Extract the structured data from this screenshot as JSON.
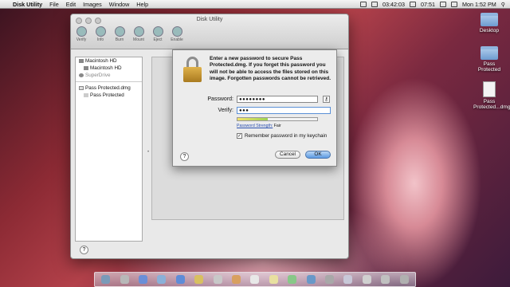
{
  "menubar": {
    "app_name": "Disk Utility",
    "items": [
      "File",
      "Edit",
      "Images",
      "Window",
      "Help"
    ],
    "clock1": "03:42:03",
    "clock2": "07:51",
    "datetime": "Mon 1:52 PM"
  },
  "desktop": {
    "icons": [
      {
        "label": "Desktop",
        "icon": "folder-icon"
      },
      {
        "label": "Pass Protected",
        "icon": "folder-icon"
      },
      {
        "label": "Pass Protected...dmg",
        "icon": "dmg-file-icon"
      }
    ]
  },
  "window": {
    "title": "Disk Utility",
    "toolbar": [
      "Verify",
      "Info",
      "Burn",
      "Mount",
      "Eject",
      "Enable"
    ],
    "sidebar": {
      "items": [
        {
          "label": "Macintosh HD",
          "level": 0
        },
        {
          "label": "Macintosh HD",
          "level": 1
        },
        {
          "label": "SuperDrive",
          "level": 0
        }
      ],
      "images": [
        {
          "label": "Pass Protected.dmg",
          "level": 0
        },
        {
          "label": "Pass Protected",
          "level": 1
        }
      ]
    },
    "help_label": "?"
  },
  "dialog": {
    "message": "Enter a new password to secure Pass Protected.dmg.  If you forget this password you will not be able to access the files stored on this image. Forgotten passwords cannot be retrieved.",
    "password_label": "Password:",
    "password_value": "●●●●●●●●",
    "verify_label": "Verify:",
    "verify_value": "●●●",
    "strength_label": "Password Strength:",
    "strength_value": "Fair",
    "strength_level": 0.38,
    "remember_label": "Remember password in my keychain",
    "remember_checked": true,
    "cancel_label": "Cancel",
    "ok_label": "OK",
    "help_label": "?"
  }
}
